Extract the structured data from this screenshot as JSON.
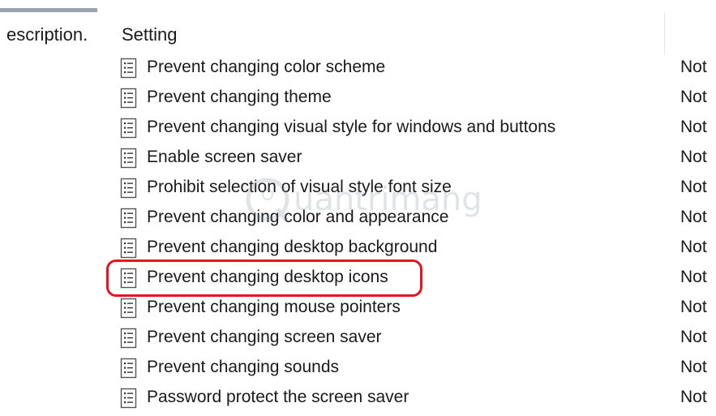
{
  "header": {
    "description_label": "escription.",
    "setting_label": "Setting"
  },
  "policies": [
    {
      "label": "Prevent changing color scheme",
      "state": "Not"
    },
    {
      "label": "Prevent changing theme",
      "state": "Not"
    },
    {
      "label": "Prevent changing visual style for windows and buttons",
      "state": "Not"
    },
    {
      "label": "Enable screen saver",
      "state": "Not"
    },
    {
      "label": "Prohibit selection of visual style font size",
      "state": "Not"
    },
    {
      "label": "Prevent changing color and appearance",
      "state": "Not"
    },
    {
      "label": "Prevent changing desktop background",
      "state": "Not"
    },
    {
      "label": "Prevent changing desktop icons",
      "state": "Not",
      "highlighted": true
    },
    {
      "label": "Prevent changing mouse pointers",
      "state": "Not"
    },
    {
      "label": "Prevent changing screen saver",
      "state": "Not"
    },
    {
      "label": "Prevent changing sounds",
      "state": "Not"
    },
    {
      "label": "Password protect the screen saver",
      "state": "Not"
    }
  ],
  "watermark": {
    "text": "uantrimang"
  },
  "icons": {
    "policy_icon": "policy-setting-icon",
    "watermark_icon": "quantrimang-logo-icon"
  },
  "colors": {
    "highlight": "#e8141f",
    "text": "#1a1a1a",
    "top_line": "#9aa4ae"
  }
}
